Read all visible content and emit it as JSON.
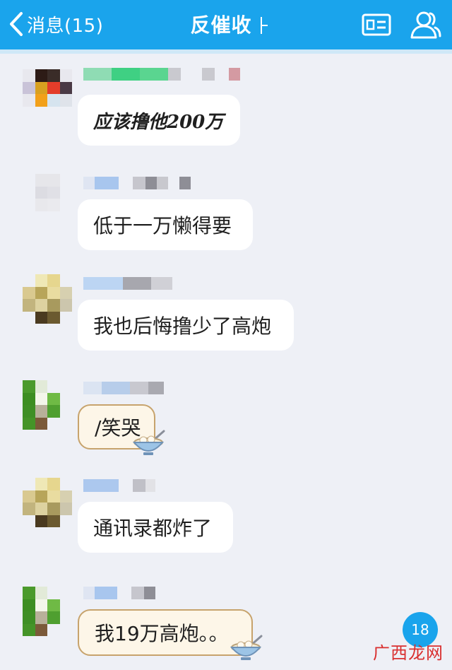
{
  "header": {
    "back_label": "消息(15)",
    "title": "反催收",
    "icons": [
      "chevron-left-icon",
      "profile-card-icon",
      "contacts-icon"
    ],
    "background": "#1aa4ec"
  },
  "messages": [
    {
      "text": "应该撸他200万",
      "style": "handwritten"
    },
    {
      "text": "低于一万懒得要",
      "style": "normal"
    },
    {
      "text": "我也后悔撸少了高炮",
      "style": "normal"
    },
    {
      "text": "/笑哭",
      "style": "decorated-bubble"
    },
    {
      "text": "通讯录都炸了",
      "style": "normal"
    },
    {
      "text": "我19万高炮。。",
      "style": "decorated-bubble"
    }
  ],
  "unread_badge": "18",
  "watermark": "广西龙网"
}
